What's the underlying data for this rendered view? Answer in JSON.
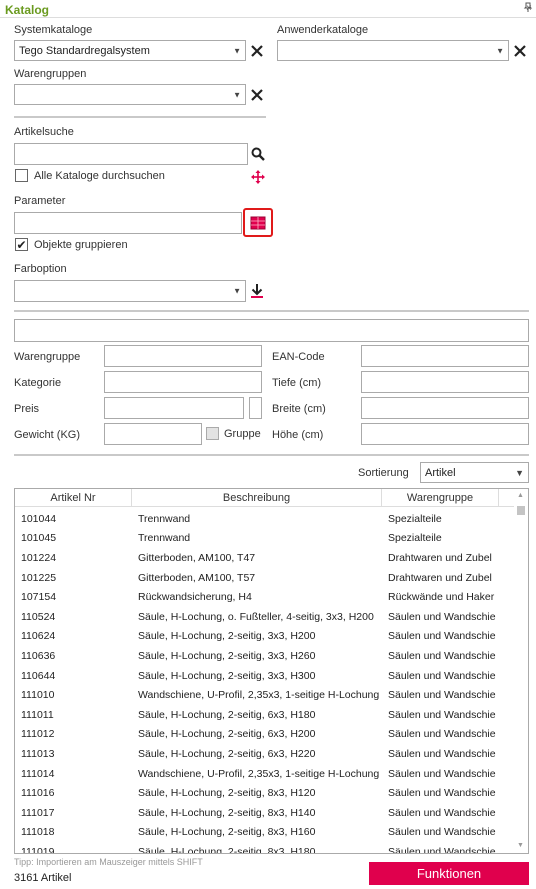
{
  "window": {
    "title": "Katalog",
    "pin_icon": "pin-icon"
  },
  "system_catalog": {
    "label": "Systemkataloge",
    "value": "Tego Standardregalsystem"
  },
  "user_catalog": {
    "label": "Anwenderkataloge",
    "value": ""
  },
  "product_groups": {
    "label": "Warengruppen",
    "value": ""
  },
  "article_search": {
    "label": "Artikelsuche",
    "value": "",
    "all_catalogs_label": "Alle Kataloge durchsuchen",
    "all_catalogs_checked": false
  },
  "parameter": {
    "label": "Parameter",
    "value": "",
    "group_objects_label": "Objekte gruppieren",
    "group_objects_checked": true
  },
  "color_option": {
    "label": "Farboption",
    "value": ""
  },
  "details": {
    "name_value": "",
    "warengruppe_label": "Warengruppe",
    "kategorie_label": "Kategorie",
    "preis_label": "Preis",
    "gewicht_label": "Gewicht (KG)",
    "gruppe_label": "Gruppe",
    "ean_label": "EAN-Code",
    "tiefe_label": "Tiefe (cm)",
    "breite_label": "Breite (cm)",
    "hoehe_label": "Höhe (cm)"
  },
  "sort": {
    "label": "Sortierung",
    "value": "Artikel"
  },
  "table": {
    "columns": [
      "Artikel Nr",
      "Beschreibung",
      "Warengruppe"
    ],
    "rows": [
      [
        "101044",
        "Trennwand",
        "Spezialteile"
      ],
      [
        "101045",
        "Trennwand",
        "Spezialteile"
      ],
      [
        "101224",
        "Gitterboden, AM100, T47",
        "Drahtwaren und Zubel"
      ],
      [
        "101225",
        "Gitterboden, AM100, T57",
        "Drahtwaren und Zubel"
      ],
      [
        "107154",
        "Rückwandsicherung, H4",
        "Rückwände und Haker"
      ],
      [
        "110524",
        "Säule, H-Lochung, o. Fußteller, 4-seitig, 3x3, H200",
        "Säulen und Wandschie"
      ],
      [
        "110624",
        "Säule, H-Lochung, 2-seitig, 3x3, H200",
        "Säulen und Wandschie"
      ],
      [
        "110636",
        "Säule, H-Lochung, 2-seitig, 3x3, H260",
        "Säulen und Wandschie"
      ],
      [
        "110644",
        "Säule, H-Lochung, 2-seitig, 3x3, H300",
        "Säulen und Wandschie"
      ],
      [
        "111010",
        "Wandschiene, U-Profil, 2,35x3, 1-seitige H-Lochung",
        "Säulen und Wandschie"
      ],
      [
        "111011",
        "Säule, H-Lochung, 2-seitig, 6x3, H180",
        "Säulen und Wandschie"
      ],
      [
        "111012",
        "Säule, H-Lochung, 2-seitig, 6x3, H200",
        "Säulen und Wandschie"
      ],
      [
        "111013",
        "Säule, H-Lochung, 2-seitig, 6x3, H220",
        "Säulen und Wandschie"
      ],
      [
        "111014",
        "Wandschiene, U-Profil, 2,35x3, 1-seitige H-Lochung",
        "Säulen und Wandschie"
      ],
      [
        "111016",
        "Säule, H-Lochung, 2-seitig, 8x3, H120",
        "Säulen und Wandschie"
      ],
      [
        "111017",
        "Säule, H-Lochung, 2-seitig, 8x3, H140",
        "Säulen und Wandschie"
      ],
      [
        "111018",
        "Säule, H-Lochung, 2-seitig, 8x3, H160",
        "Säulen und Wandschie"
      ],
      [
        "111019",
        "Säule, H-Lochung, 2-seitig, 8x3, H180",
        "Säulen und Wandschie"
      ]
    ]
  },
  "footer": {
    "tip": "Tipp: Importieren am Mauszeiger mittels SHIFT",
    "count": "3161 Artikel",
    "functions_button": "Funktionen"
  },
  "colors": {
    "title_green": "#6a9a1f",
    "accent_red": "#e0004d"
  }
}
